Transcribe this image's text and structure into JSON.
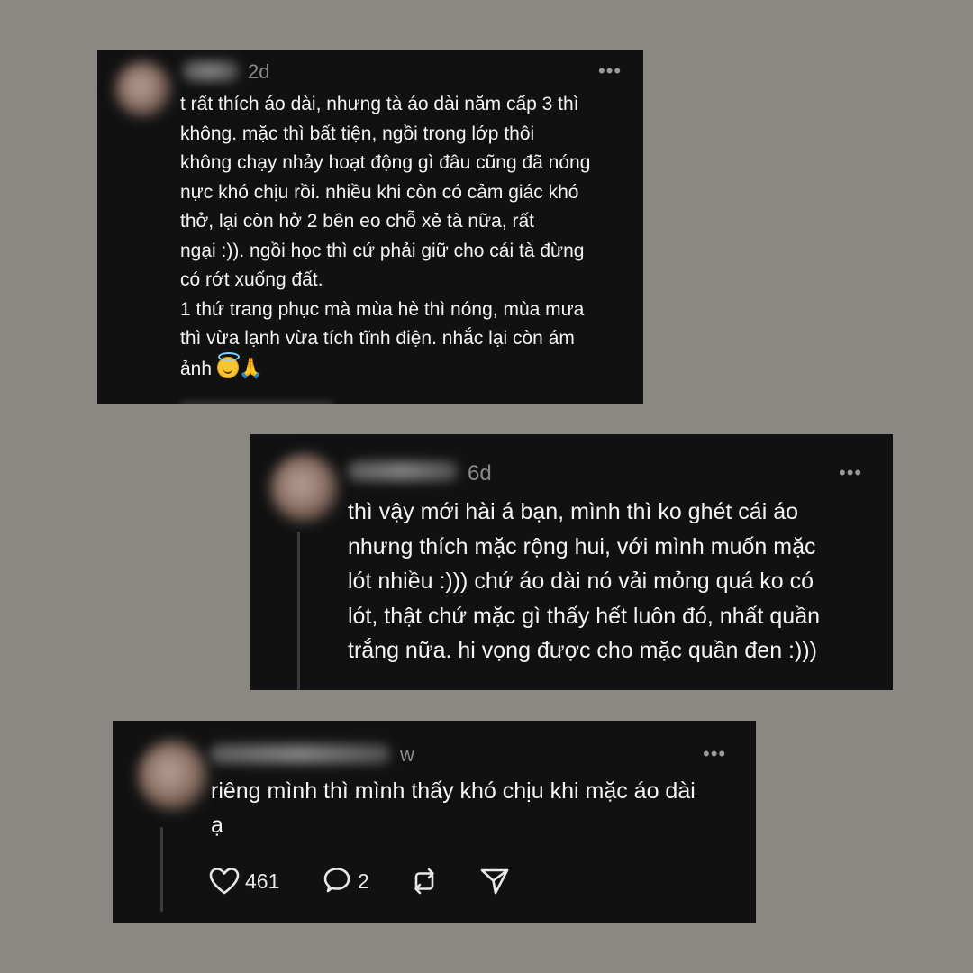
{
  "posts": [
    {
      "time": "2d",
      "more": "•••",
      "text": "t rất thích áo dài, nhưng tà áo dài năm cấp 3 thì\nkhông. mặc thì bất tiện, ngồi trong lớp thôi\nkhông chạy nhảy hoạt động gì đâu cũng đã nóng\nnực khó chịu rồi. nhiều khi còn có cảm giác khó\nthở, lại còn hở 2 bên eo chỗ xẻ tà nữa, rất\nngại :)). ngồi học thì cứ phải giữ cho cái tà đừng\ncó rớt xuống đất.\n1 thứ trang phục mà mùa hè thì nóng, mùa mưa\nthì vừa lạnh vừa tích tĩnh điện. nhắc lại còn ám\nảnh",
      "emoji": [
        "smiling-face-with-halo",
        "folded-hands"
      ]
    },
    {
      "time": "6d",
      "more": "•••",
      "text": "thì vậy mới hài á bạn, mình thì ko ghét cái áo\nnhưng thích mặc rộng hui, với mình muốn mặc\nlót nhiều :))) chứ áo dài nó vải mỏng quá ko có\nlót, thật chứ mặc gì thấy hết luôn đó, nhất quần\ntrắng nữa. hi vọng được cho mặc quần đen :)))"
    },
    {
      "time": "w",
      "more": "•••",
      "text": "riêng mình thì mình thấy khó chịu khi mặc áo dài\nạ",
      "actions": {
        "likes": "461",
        "replies": "2"
      }
    }
  ],
  "icons": {
    "like": "heart-icon",
    "reply": "speech-bubble-icon",
    "repost": "repost-icon",
    "share": "send-icon"
  },
  "colors": {
    "background": "#8b8782",
    "card": "#111111",
    "text": "#f4f4f4",
    "muted": "#8a8a8a"
  }
}
